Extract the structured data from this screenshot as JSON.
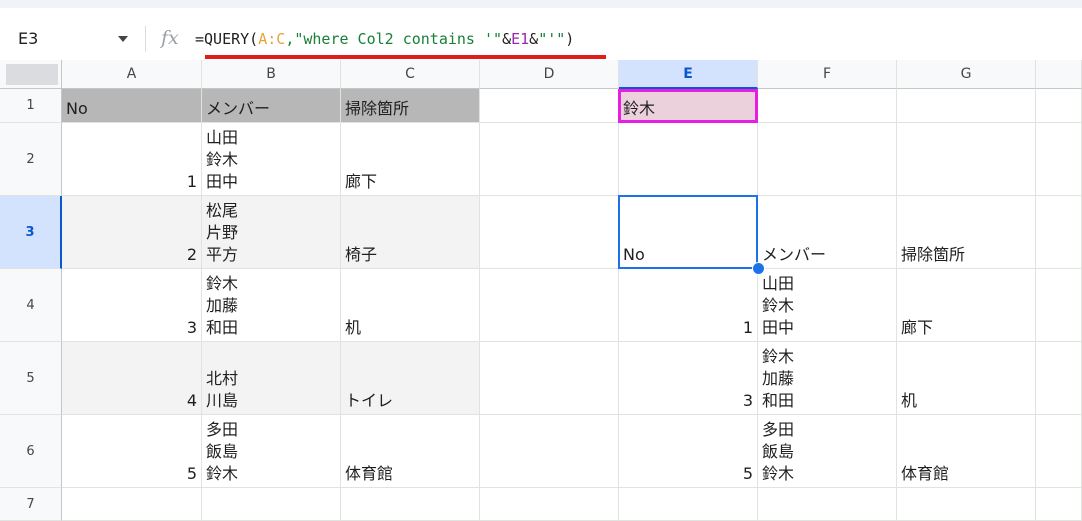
{
  "name_box": "E3",
  "fx_icon": "fx",
  "formula": {
    "segments": [
      {
        "text": "=QUERY(",
        "style": "default"
      },
      {
        "text": "A:C",
        "style": "range"
      },
      {
        "text": ",\"where Col2 contains '\"",
        "style": "string"
      },
      {
        "text": "&",
        "style": "default"
      },
      {
        "text": "E1",
        "style": "ref"
      },
      {
        "text": "&",
        "style": "default"
      },
      {
        "text": "\"'\"",
        "style": "string"
      },
      {
        "text": ")",
        "style": "default"
      }
    ]
  },
  "columns": [
    "A",
    "B",
    "C",
    "D",
    "E",
    "F",
    "G"
  ],
  "rows": [
    "1",
    "2",
    "3",
    "4",
    "5",
    "6",
    "7"
  ],
  "selected_cell": "E3",
  "cells": {
    "A1": "No",
    "B1": "メンバー",
    "C1": "掃除箇所",
    "E1": "鈴木",
    "A2": "1",
    "B2": "山田\n鈴木\n田中",
    "C2": "廊下",
    "A3": "2",
    "B3": "松尾\n片野\n平方",
    "C3": "椅子",
    "E3": "No",
    "F3": "メンバー",
    "G3": "掃除箇所",
    "A4": "3",
    "B4": "鈴木\n加藤\n和田",
    "C4": "机",
    "E4": "1",
    "F4": "山田\n鈴木\n田中",
    "G4": "廊下",
    "A5": "4",
    "B5": "北村\n川島",
    "C5": "トイレ",
    "E5": "3",
    "F5": "鈴木\n加藤\n和田",
    "G5": "机",
    "A6": "5",
    "B6": "多田\n飯島\n鈴木",
    "C6": "体育館",
    "E6": "5",
    "F6": "多田\n飯島\n鈴木",
    "G6": "体育館"
  },
  "colors": {
    "header_fill": "#b7b7b7",
    "band_fill": "#f3f3f3",
    "search_fill": "#ead1dc",
    "search_border": "#e91ee3",
    "selection": "#1a73e8",
    "annotation_underline": "#e21b1b"
  }
}
